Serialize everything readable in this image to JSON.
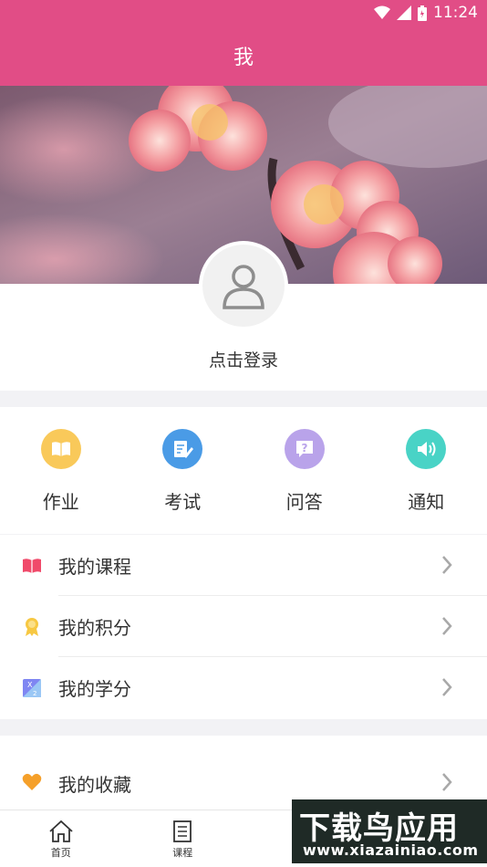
{
  "status_bar": {
    "time": "11:24"
  },
  "header": {
    "title": "我"
  },
  "profile": {
    "login_text": "点击登录"
  },
  "quick_actions": [
    {
      "label": "作业",
      "icon": "book-icon",
      "color": "#f9c95a"
    },
    {
      "label": "考试",
      "icon": "exam-edit-icon",
      "color": "#4a9be6"
    },
    {
      "label": "问答",
      "icon": "question-icon",
      "color": "#b9a3ea"
    },
    {
      "label": "通知",
      "icon": "speaker-icon",
      "color": "#49d3c6"
    }
  ],
  "menu": {
    "section1": [
      {
        "label": "我的课程",
        "icon": "open-book-icon",
        "color": "#f04a6a"
      },
      {
        "label": "我的积分",
        "icon": "medal-icon",
        "color": "#f7c843"
      },
      {
        "label": "我的学分",
        "icon": "credit-icon",
        "color": "#7f86f2"
      }
    ],
    "section2": [
      {
        "label": "我的收藏",
        "icon": "heart-icon",
        "color": "#f5a02a"
      }
    ]
  },
  "tabbar": [
    {
      "label": "首页",
      "icon": "home-icon"
    },
    {
      "label": "课程",
      "icon": "list-doc-icon"
    }
  ],
  "watermark": {
    "line1": "下载鸟应用",
    "line2": "www.xiazainiao.com"
  },
  "colors": {
    "primary": "#e14d86",
    "background": "#f2f2f5"
  }
}
